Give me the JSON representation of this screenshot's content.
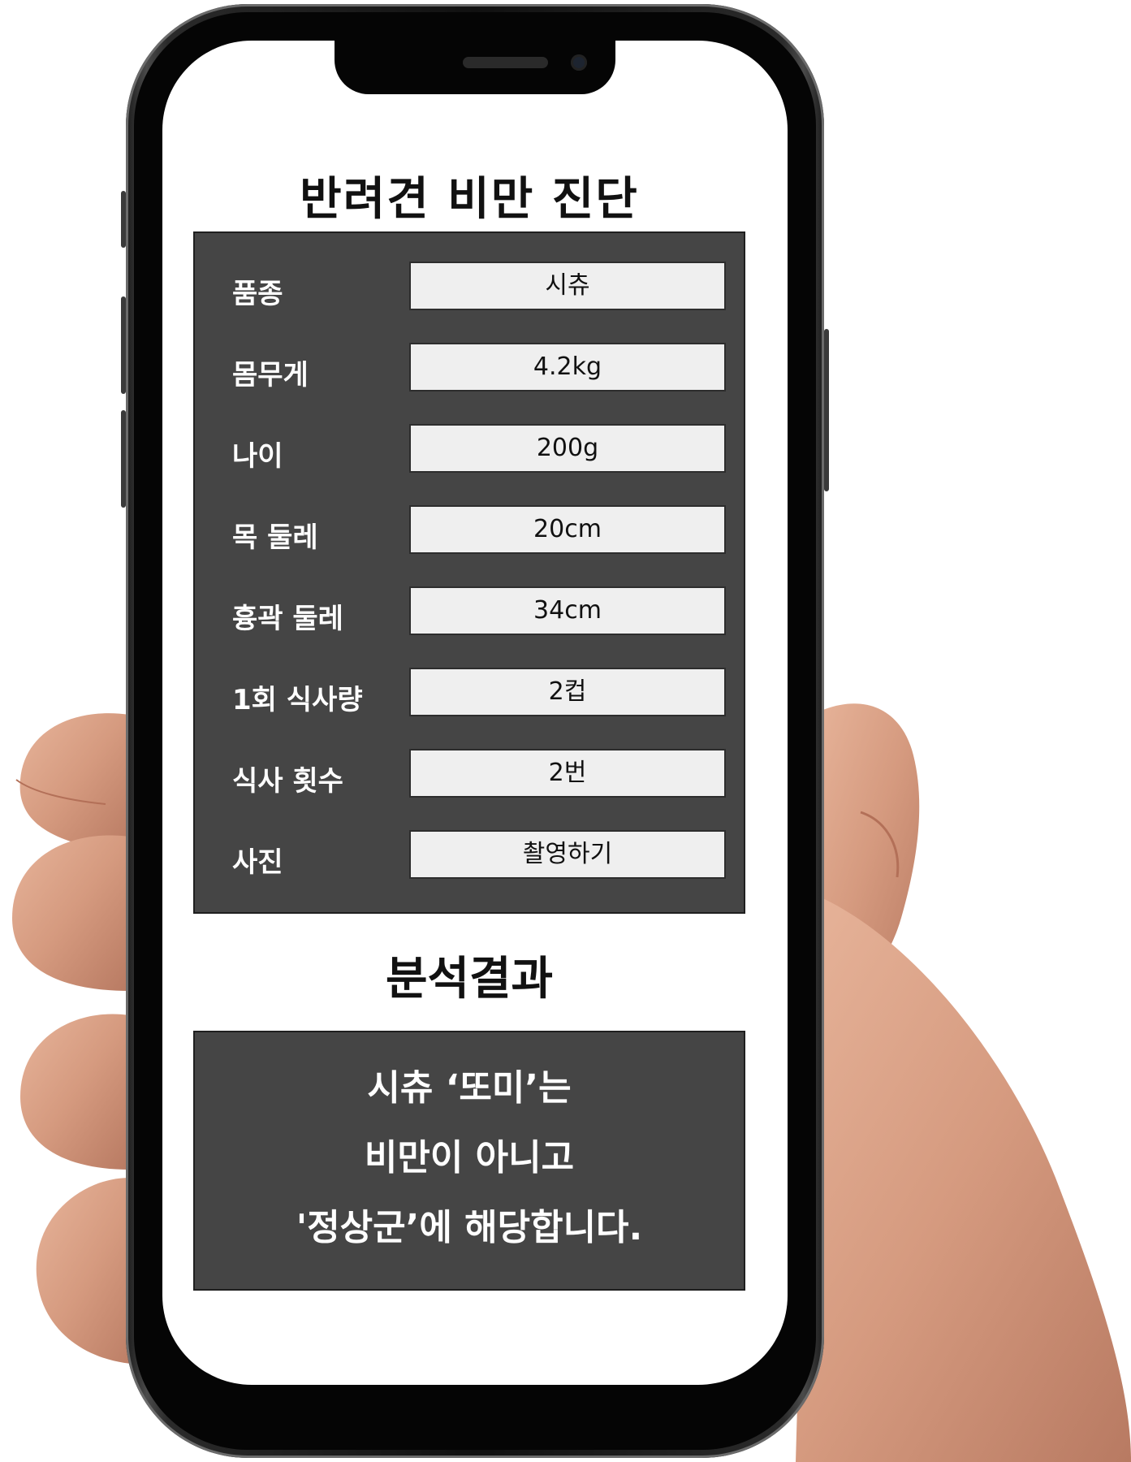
{
  "app": {
    "title": "반려견 비만 진단",
    "section_title": "분석결과"
  },
  "form": {
    "fields": [
      {
        "label": "품종",
        "value": "시츄"
      },
      {
        "label": "몸무게",
        "value": "4.2kg"
      },
      {
        "label": "나이",
        "value": "200g"
      },
      {
        "label": "목 둘레",
        "value": "20cm"
      },
      {
        "label": "흉곽 둘레",
        "value": "34cm"
      },
      {
        "label": "1회 식사량",
        "value": "2컵"
      },
      {
        "label": "식사 횟수",
        "value": "2번"
      },
      {
        "label": "사진",
        "value": "촬영하기"
      }
    ]
  },
  "result": {
    "lines": [
      "시츄 ‘또미’는",
      "비만이 아니고",
      "'정상군’에 해당합니다."
    ]
  },
  "colors": {
    "panel": "#454545",
    "field": "#efefef",
    "text_dark": "#111111",
    "text_light": "#ffffff"
  },
  "icons": [
    "hand-illustration",
    "phone-frame",
    "front-camera-icon",
    "speaker-grille"
  ]
}
